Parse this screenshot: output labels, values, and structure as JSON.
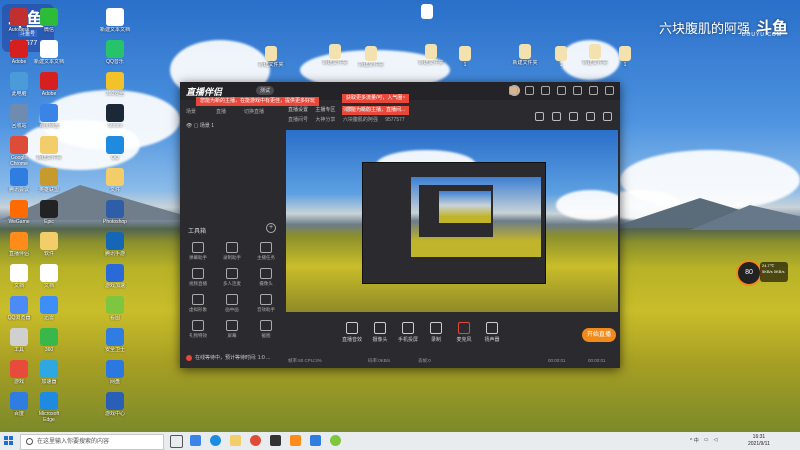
{
  "stream": {
    "watermark": "六块腹肌的阿强",
    "watermark_logo": "斗鱼",
    "watermark_sub": "DOUYU.COM",
    "corner_logo": "斗鱼",
    "corner_badge": "斗鱼号",
    "corner_id": "9577577"
  },
  "desktop_icons": [
    {
      "label": "Autodesk",
      "color": "#c03030"
    },
    {
      "label": "微信",
      "color": "#2dbb3a"
    },
    {
      "label": "新建文本文档",
      "color": "#ffffff"
    },
    {
      "label": "Adobe",
      "color": "#d62020"
    },
    {
      "label": "新建文本文档",
      "color": "#ffffff"
    },
    {
      "label": "QQ音乐",
      "color": "#26c36a"
    },
    {
      "label": "此电脑",
      "color": "#4a9bd8"
    },
    {
      "label": "Adobe",
      "color": "#d62020"
    },
    {
      "label": "360安全",
      "color": "#f2c22a"
    },
    {
      "label": "回收站",
      "color": "#6f8cb0"
    },
    {
      "label": "百度网盘",
      "color": "#3a84e8"
    },
    {
      "label": "Steam",
      "color": "#1b2838"
    },
    {
      "label": "Google Chrome",
      "color": "#dd4b39"
    },
    {
      "label": "新建文件夹",
      "color": "#f3cd6a"
    },
    {
      "label": "QQ",
      "color": "#1f8be0"
    },
    {
      "label": "腾讯会议",
      "color": "#2f7de1"
    },
    {
      "label": "英雄联盟",
      "color": "#c79a2e"
    },
    {
      "label": "文件",
      "color": "#f3cd6a"
    },
    {
      "label": "WeGame",
      "color": "#ff6b00"
    },
    {
      "label": "Epic",
      "color": "#222222"
    },
    {
      "label": "Photoshop",
      "color": "#2e5ea8"
    },
    {
      "label": "直播伴侣",
      "color": "#ff8b1b"
    },
    {
      "label": "软件",
      "color": "#f3cd6a"
    },
    {
      "label": "腾讯手游",
      "color": "#1666b6"
    },
    {
      "label": "文档",
      "color": "#ffffff"
    },
    {
      "label": "文档",
      "color": "#ffffff"
    },
    {
      "label": "游戏加速",
      "color": "#2a6ad8"
    },
    {
      "label": "QQ浏览器",
      "color": "#4c8bf5"
    },
    {
      "label": "迅雷",
      "color": "#3e8ef7"
    },
    {
      "label": "看图",
      "color": "#7ec540"
    },
    {
      "label": "工具",
      "color": "#d0d0d0"
    },
    {
      "label": "360",
      "color": "#3ab74a"
    },
    {
      "label": "安全卫士",
      "color": "#2f7de1"
    },
    {
      "label": "游戏",
      "color": "#e84b3c"
    },
    {
      "label": "加速器",
      "color": "#2fa7e0"
    },
    {
      "label": "网盘",
      "color": "#2b79e0"
    },
    {
      "label": "百度",
      "color": "#2f7de1"
    },
    {
      "label": "Microsoft Edge",
      "color": "#1e8be0"
    },
    {
      "label": "游戏中心",
      "color": "#2a5fb8"
    }
  ],
  "top_folders": [
    "新建文件夹",
    "新建文件夹",
    "新建文件夹",
    "新建文件夹",
    "1",
    "新建文件夹",
    "1",
    "新建文件夹",
    "1"
  ],
  "app": {
    "title": "直播伴侣",
    "badge": "测试",
    "notice_1": "您能为新的主播，在能游戏中有更佳，提供更多好玩",
    "notice_2": "您能为新的主播，直播间...",
    "notice_3": "获取更多流量/可，入气圈~",
    "left_tabs": [
      "场景",
      "直播",
      "切换直播"
    ],
    "scene_item": "场景 1",
    "tools_label": "工具箱",
    "tools": [
      "弹幕助手",
      "录制助手",
      "主播任务",
      "视频直播",
      "多人连麦",
      "摄像头",
      "虚拟形象",
      "画中画",
      "音效助手",
      "礼物特效",
      "屏幕",
      "截图"
    ],
    "hint": "在线等待中，预计等待时间: 1:0 ...",
    "main_tabs": [
      "直播设置",
      "主播专区",
      "弹幕",
      "消息"
    ],
    "info": [
      "直播间号",
      "大神分享",
      "六块腹肌的阿强",
      "9577577"
    ],
    "controls": [
      "直播音效",
      "摄像头",
      "手机投屏",
      "录制",
      "麦克风",
      "扬声器"
    ],
    "go_live": "开始直播",
    "status": [
      "帧率:60 CPU:3%",
      "码率:0KB/s",
      "丢帧:0",
      "00:00:01",
      "00:00:01"
    ]
  },
  "overlay": {
    "gauge": "80",
    "info": "24.7℃ 5KB/s 0KB/s"
  },
  "taskbar": {
    "search_placeholder": "在这里输入你要搜索的内容",
    "tray": "^ 中",
    "time": "16:31",
    "date": "2021/9/11"
  }
}
